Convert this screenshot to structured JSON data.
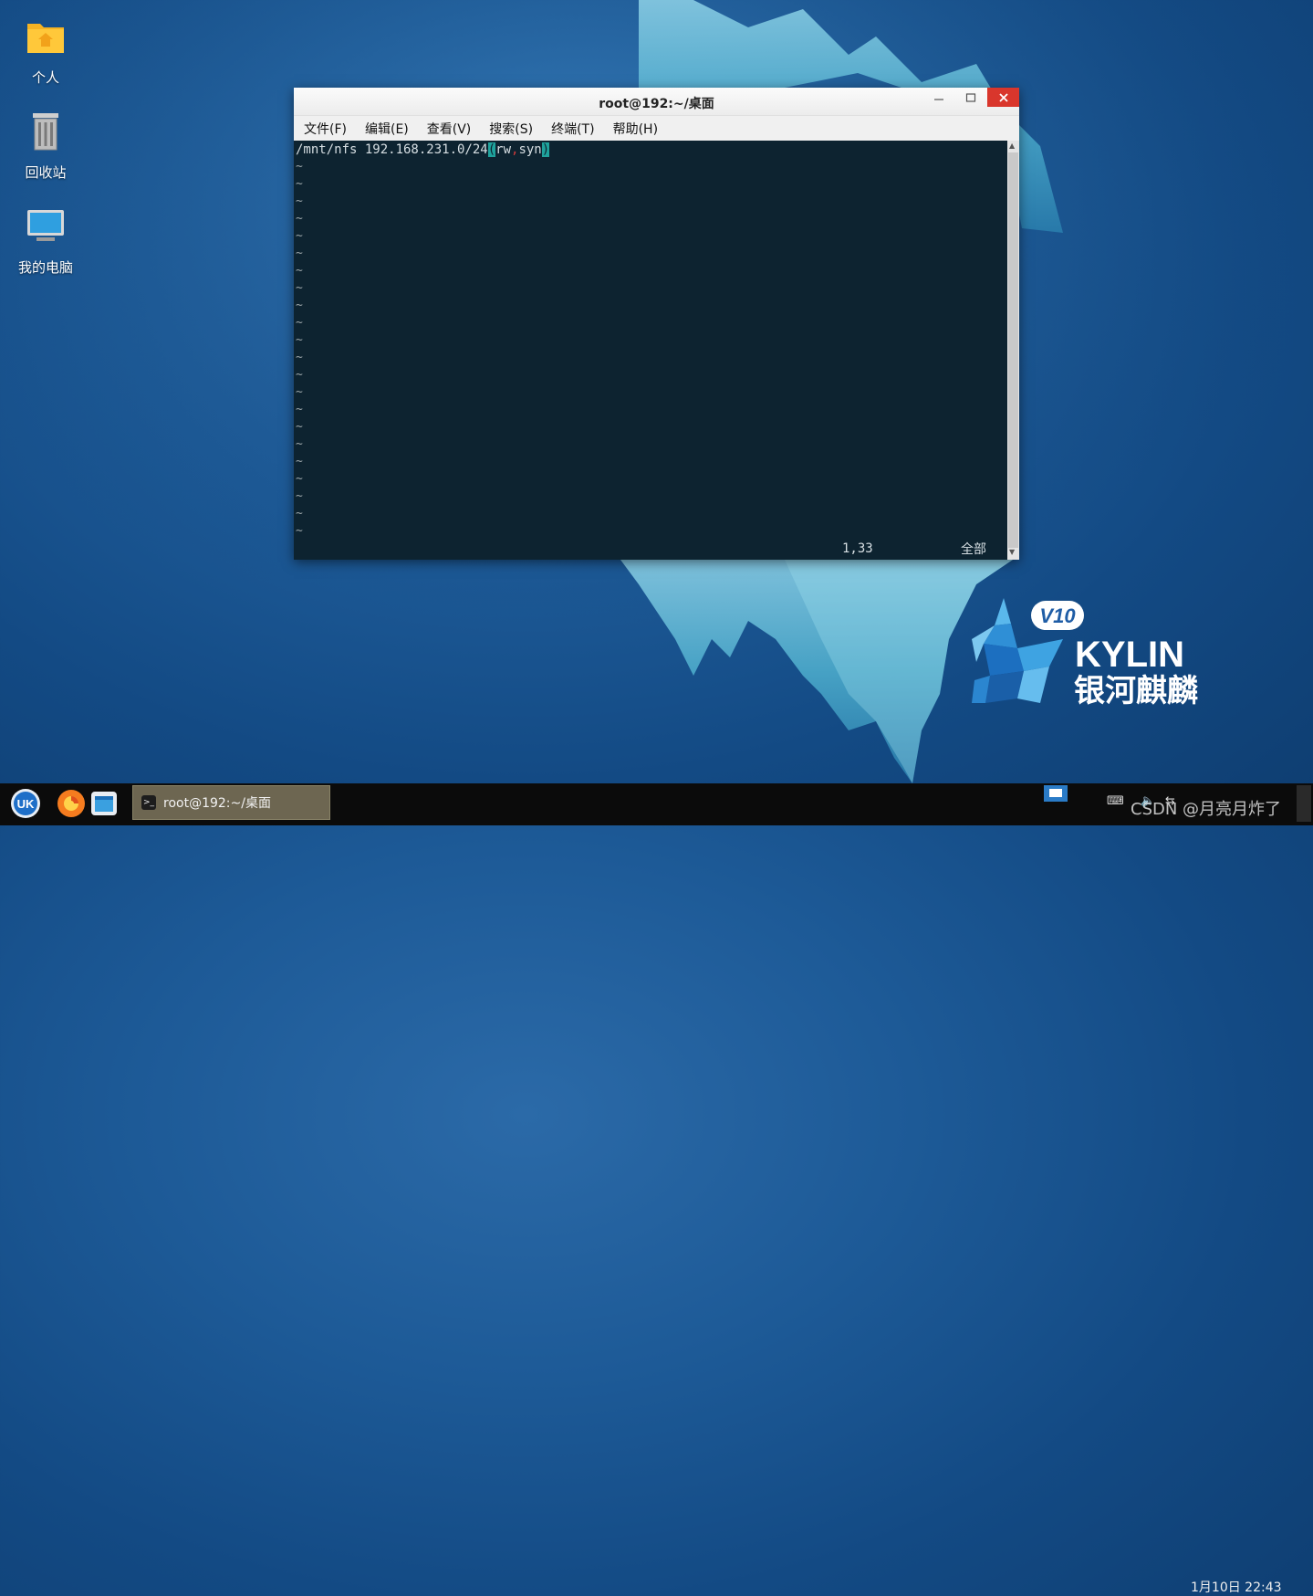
{
  "desktop": {
    "icons": [
      {
        "label": "个人",
        "icon": "folder-home-icon"
      },
      {
        "label": "回收站",
        "icon": "trash-icon"
      },
      {
        "label": "我的电脑",
        "icon": "computer-icon"
      }
    ]
  },
  "window": {
    "title": "root@192:~/桌面",
    "menu": [
      "文件(F)",
      "编辑(E)",
      "查看(V)",
      "搜索(S)",
      "终端(T)",
      "帮助(H)"
    ],
    "terminal": {
      "line_prefix": "/mnt/nfs 192.168.231.0/24",
      "open_paren": "(",
      "opt1": "rw",
      "comma": ",",
      "opt2": "syn",
      "close_paren": ")",
      "empty_marker": "~",
      "cursor_position": "1,33",
      "scroll_indicator": "全部"
    }
  },
  "logo": {
    "version": "V10",
    "name": "KYLIN",
    "chinese_name": "银河麒麟"
  },
  "taskbar": {
    "task_title": "root@192:~/桌面",
    "clock": "1月10日 22:43",
    "watermark": "CSDN @月亮月炸了"
  },
  "colors": {
    "terminal_bg": "#0d2330",
    "highlight": "#1fa29c",
    "close_button": "#d9362c",
    "task_item": "#6d6651"
  }
}
